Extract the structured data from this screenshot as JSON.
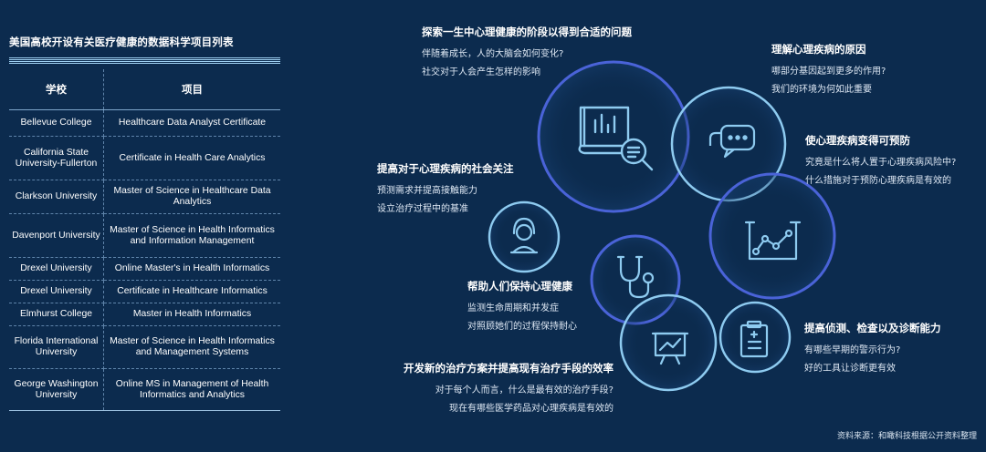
{
  "table": {
    "title": "美国高校开设有关医疗健康的数据科学项目列表",
    "headers": {
      "school": "学校",
      "program": "项目"
    },
    "rows": [
      {
        "school": "Bellevue College",
        "program": "Healthcare Data Analyst Certificate"
      },
      {
        "school": "California State University-Fullerton",
        "program": "Certificate in Health Care Analytics"
      },
      {
        "school": "Clarkson University",
        "program": "Master of Science in Healthcare Data Analytics"
      },
      {
        "school": "Davenport University",
        "program": "Master of Science in Health Informatics and Information Management"
      },
      {
        "school": "Drexel University",
        "program": "Online Master's in Health Informatics"
      },
      {
        "school": "Drexel University",
        "program": "Certificate in Healthcare Informatics"
      },
      {
        "school": "Elmhurst College",
        "program": "Master in Health Informatics"
      },
      {
        "school": "Florida International University",
        "program": "Master of Science in Health Informatics and Management Systems"
      },
      {
        "school": "George Washington University",
        "program": "Online MS in Management of Health Informatics and Analytics"
      }
    ]
  },
  "diagram": {
    "colors": {
      "background": "#0c2b4e",
      "ring_blue": "#4a63d8",
      "ring_light": "#8ecbf0"
    },
    "items": [
      {
        "id": "stages",
        "heading": "探索一生中心理健康的阶段以得到合适的问题",
        "lines": [
          "伴随着成长，人的大脑会如何变化?",
          "社交对于人会产生怎样的影响"
        ],
        "icon": "book-chart-icon"
      },
      {
        "id": "causes",
        "heading": "理解心理疾病的原因",
        "lines": [
          "哪部分基因起到更多的作用?",
          "我们的环境为何如此重要"
        ],
        "icon": "chat-bubble-icon"
      },
      {
        "id": "prevent",
        "heading": "使心理疾病变得可预防",
        "lines": [
          "究竟是什么将人置于心理疾病风险中?",
          "什么措施对于预防心理疾病是有效的"
        ],
        "icon": "line-chart-icon"
      },
      {
        "id": "social",
        "heading": "提高对于心理疾病的社会关注",
        "lines": [
          "预测需求并提高接触能力",
          "设立治疗过程中的基准"
        ],
        "icon": "user-icon"
      },
      {
        "id": "help",
        "heading": "帮助人们保持心理健康",
        "lines": [
          "监测生命周期和并发症",
          "对照顾她们的过程保持耐心"
        ],
        "icon": "stethoscope-icon"
      },
      {
        "id": "detect",
        "heading": "提高侦测、检查以及诊断能力",
        "lines": [
          "有哪些早期的警示行为?",
          "好的工具让诊断更有效"
        ],
        "icon": "clipboard-icon"
      },
      {
        "id": "treat",
        "heading": "开发新的治疗方案并提高现有治疗手段的效率",
        "lines": [
          "对于每个人而言，什么是最有效的治疗手段?",
          "现在有哪些医学药品对心理疾病是有效的"
        ],
        "icon": "presentation-chart-icon"
      }
    ]
  },
  "source": "资料来源：和瞰科技根据公开资料整理"
}
